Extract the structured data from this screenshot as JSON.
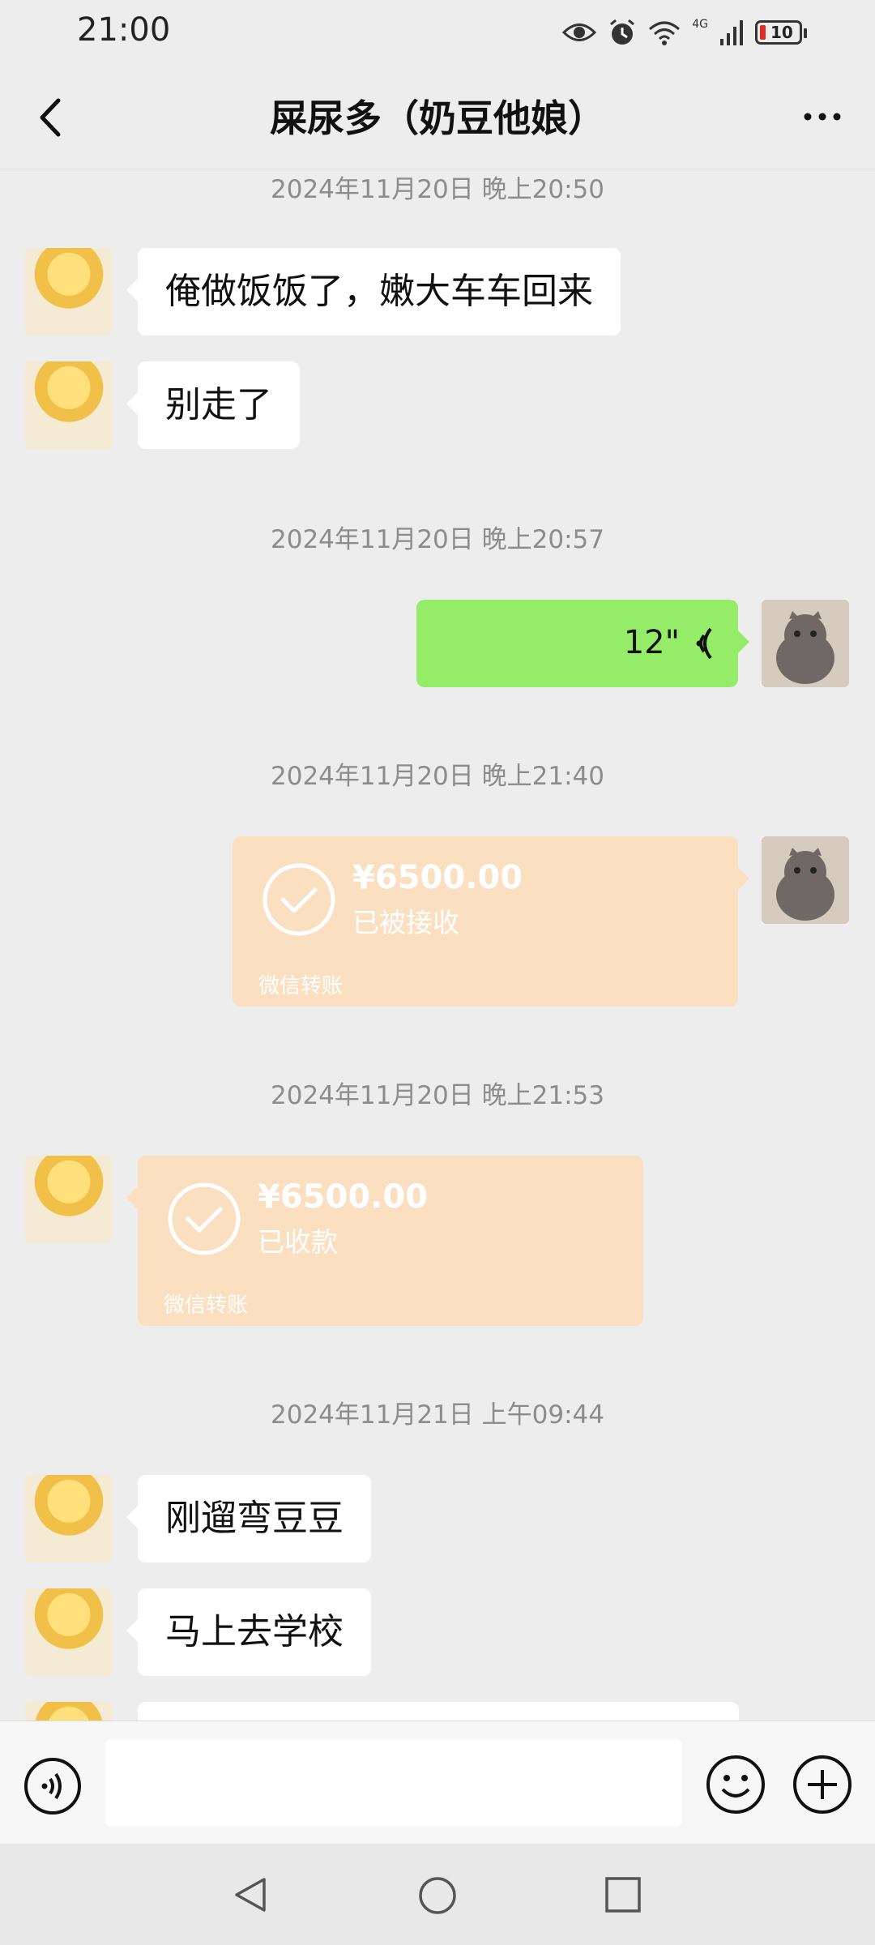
{
  "status_bar": {
    "time": "21:00",
    "network": "4G",
    "battery": "10",
    "icons": [
      "eye-icon",
      "alarm-icon",
      "wifi-icon",
      "signal-icon",
      "battery-icon"
    ]
  },
  "header": {
    "title": "屎尿多（奶豆他娘）",
    "back_icon": "chevron-left-icon",
    "more_icon": "more-icon"
  },
  "messages": [
    {
      "type": "timestamp",
      "text": "2024年11月20日 晚上20:50"
    },
    {
      "type": "text",
      "side": "left",
      "text": "俺做饭饭了，嫩大车车回来"
    },
    {
      "type": "text",
      "side": "left",
      "text": "别走了"
    },
    {
      "type": "timestamp",
      "text": "2024年11月20日 晚上20:57"
    },
    {
      "type": "voice",
      "side": "right",
      "duration": "12\""
    },
    {
      "type": "timestamp",
      "text": "2024年11月20日 晚上21:40"
    },
    {
      "type": "transfer",
      "side": "right",
      "amount": "¥6500.00",
      "status": "已被接收",
      "label": "微信转账"
    },
    {
      "type": "timestamp",
      "text": "2024年11月20日 晚上21:53"
    },
    {
      "type": "transfer",
      "side": "left",
      "amount": "¥6500.00",
      "status": "已收款",
      "label": "微信转账"
    },
    {
      "type": "timestamp",
      "text": "2024年11月21日 上午09:44"
    },
    {
      "type": "text",
      "side": "left",
      "text": "刚遛弯豆豆"
    },
    {
      "type": "text",
      "side": "left",
      "text": "马上去学校"
    }
  ],
  "input_bar": {
    "voice_icon": "voice-input-icon",
    "emoji_icon": "emoji-icon",
    "plus_icon": "plus-icon",
    "value": ""
  },
  "system_nav": [
    "back-triangle-icon",
    "home-circle-icon",
    "recents-square-icon"
  ],
  "colors": {
    "background": "#ededed",
    "sent_bubble": "#95ec69",
    "received_bubble": "#ffffff",
    "transfer_card": "#fbdfc1",
    "timestamp": "#8c8c8c"
  }
}
